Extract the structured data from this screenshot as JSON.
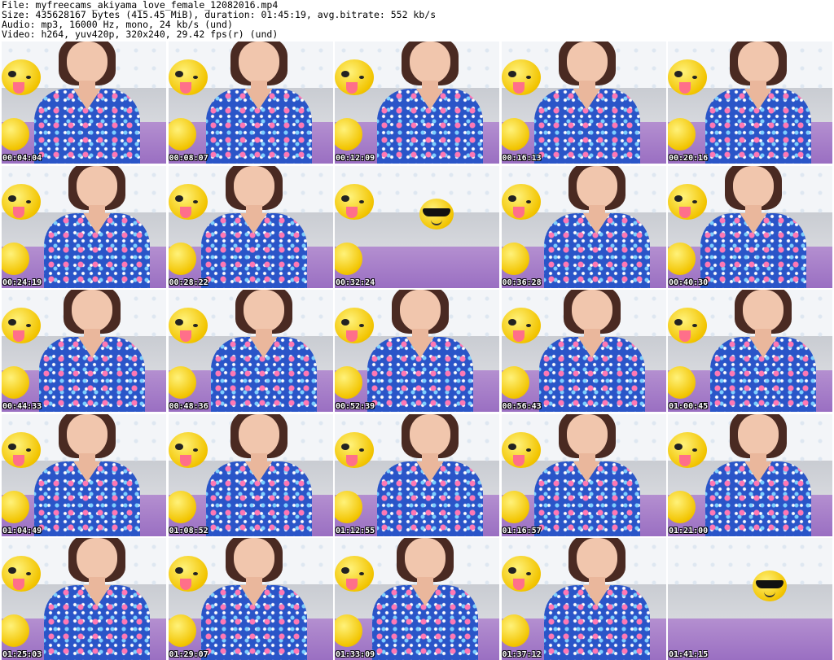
{
  "header": {
    "file_line": "File: myfreecams_akiyama_love_female_12082016.mp4",
    "size_line": "Size: 435628167 bytes (415.45 MiB), duration: 01:45:19, avg.bitrate: 552 kb/s",
    "audio_line": "Audio: mp3, 16000 Hz, mono, 24 kb/s (und)",
    "video_line": "Video: h264, yuv420p, 320x240, 29.42 fps(r) (und)"
  },
  "thumbnails": [
    {
      "time": "00:04:04",
      "scene": "person"
    },
    {
      "time": "00:08:07",
      "scene": "person"
    },
    {
      "time": "00:12:09",
      "scene": "person"
    },
    {
      "time": "00:16:13",
      "scene": "person"
    },
    {
      "time": "00:20:16",
      "scene": "person"
    },
    {
      "time": "00:24:19",
      "scene": "person"
    },
    {
      "time": "00:28:22",
      "scene": "person"
    },
    {
      "time": "00:32:24",
      "scene": "empty-sunglasses"
    },
    {
      "time": "00:36:28",
      "scene": "person"
    },
    {
      "time": "00:40:30",
      "scene": "person"
    },
    {
      "time": "00:44:33",
      "scene": "person"
    },
    {
      "time": "00:48:36",
      "scene": "person"
    },
    {
      "time": "00:52:39",
      "scene": "person"
    },
    {
      "time": "00:56:43",
      "scene": "person"
    },
    {
      "time": "01:00:45",
      "scene": "person"
    },
    {
      "time": "01:04:49",
      "scene": "person"
    },
    {
      "time": "01:08:52",
      "scene": "person"
    },
    {
      "time": "01:12:55",
      "scene": "person"
    },
    {
      "time": "01:16:57",
      "scene": "person"
    },
    {
      "time": "01:21:00",
      "scene": "person"
    },
    {
      "time": "01:25:03",
      "scene": "person"
    },
    {
      "time": "01:29:07",
      "scene": "person"
    },
    {
      "time": "01:33:09",
      "scene": "person"
    },
    {
      "time": "01:37:12",
      "scene": "person"
    },
    {
      "time": "01:41:15",
      "scene": "empty-sunglasses"
    }
  ]
}
